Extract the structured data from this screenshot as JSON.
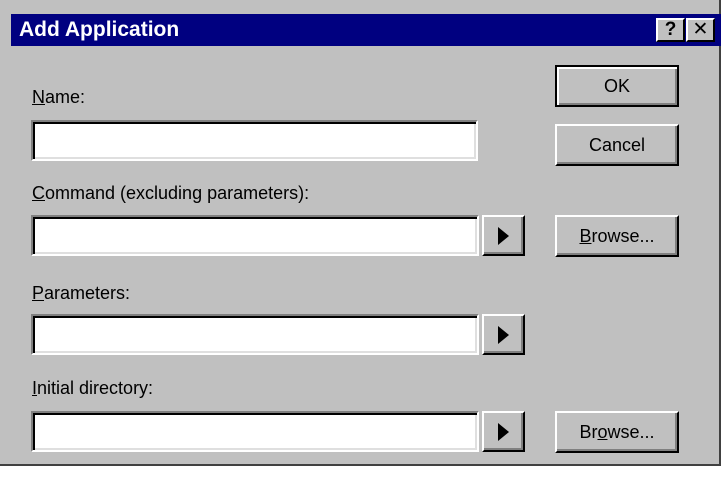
{
  "title": "Add Application",
  "title_buttons": {
    "help": "?",
    "close": "✕"
  },
  "fields": {
    "name": {
      "label_key": "N",
      "label_rest": "ame:",
      "value": ""
    },
    "command": {
      "label_key": "C",
      "label_rest": "ommand (excluding parameters):",
      "value": ""
    },
    "parameters": {
      "label_key": "P",
      "label_rest": "arameters:",
      "value": ""
    },
    "initial_dir": {
      "label_key": "I",
      "label_rest": "nitial directory:",
      "value": ""
    }
  },
  "buttons": {
    "ok": "OK",
    "cancel": "Cancel",
    "browse_key": "B",
    "browse_rest": "rowse...",
    "browse2_pre": "Br",
    "browse2_key": "o",
    "browse2_rest": "wse..."
  },
  "icons": {
    "arrow": "right-arrow-icon",
    "help": "help-icon",
    "close": "close-icon"
  },
  "colors": {
    "face": "#c0c0c0",
    "titlebar": "#000080",
    "title_text": "#ffffff"
  }
}
